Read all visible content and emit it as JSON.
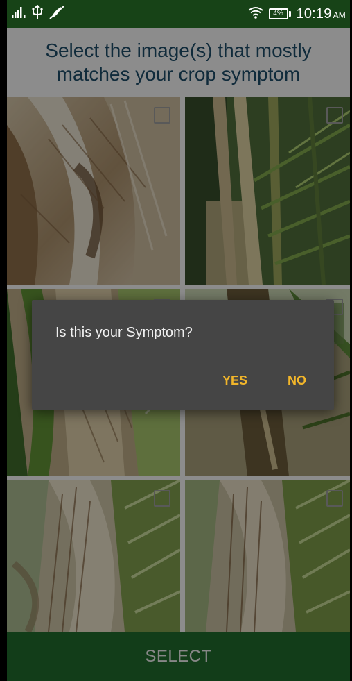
{
  "status_bar": {
    "time": "10:19",
    "ampm": "AM",
    "battery": "4%",
    "icons": [
      "signal-icon",
      "usb-icon",
      "no-notifications-icon",
      "wifi-icon",
      "battery-icon"
    ]
  },
  "header": {
    "title": "Select the image(s) that mostly matches your crop symptom"
  },
  "grid": {
    "tiles": [
      {
        "image": "palm-trunk-fibrous-base-photo",
        "selected": false
      },
      {
        "image": "palm-fronds-stems-photo",
        "selected": false
      },
      {
        "image": "palm-trunk-frond-base-photo",
        "selected": false
      },
      {
        "image": "palm-trunk-yard-photo",
        "selected": false
      },
      {
        "image": "palm-crown-fibrous-photo",
        "selected": false
      },
      {
        "image": "palm-crown-fibrous-closeup-photo",
        "selected": false
      }
    ]
  },
  "select_button": {
    "label": "SELECT"
  },
  "dialog": {
    "message": "Is this your Symptom?",
    "yes_label": "YES",
    "no_label": "NO"
  },
  "colors": {
    "status_bar": "#174317",
    "select_bar": "#1f6a2c",
    "header_text": "#1d4a66",
    "dialog_bg": "#454545",
    "accent": "#f1b52a"
  }
}
